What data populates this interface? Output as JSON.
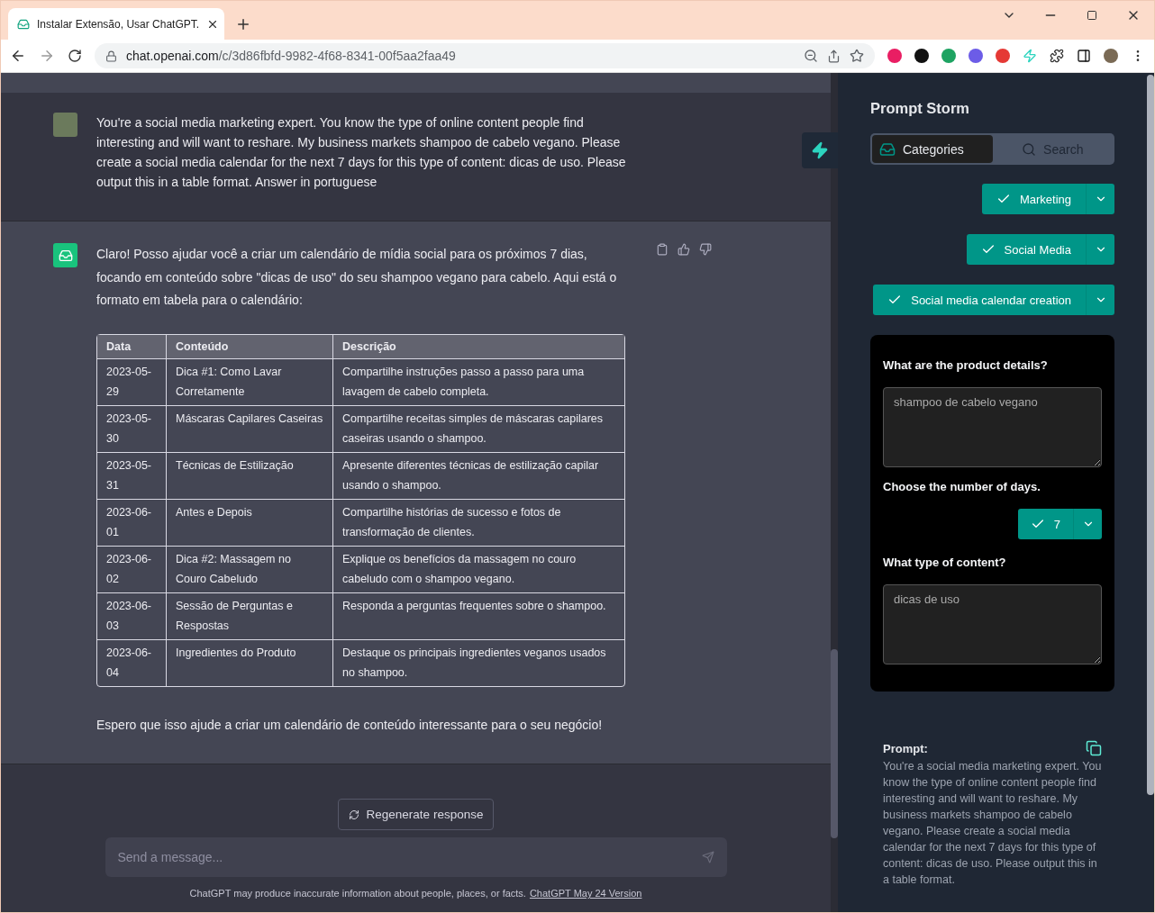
{
  "browser": {
    "tab": {
      "title": "Instalar Extensão, Usar ChatGPT."
    },
    "url": {
      "host": "chat.openai.com",
      "path": "/c/3d86fbfd-9982-4f68-8341-00f5aa2faa49"
    }
  },
  "chat": {
    "messages": [
      {
        "kind": "user",
        "paragraphs": [
          "You're a social media marketing expert. You know the type of online content people find interesting and will want to reshare. My business markets shampoo de cabelo vegano. Please create a social media calendar for the next 7 days for this type of content: dicas de uso. Please output this in a table format. Answer in portuguese"
        ]
      },
      {
        "kind": "assistant",
        "paragraphs": [
          "Claro! Posso ajudar você a criar um calendário de mídia social para os próximos 7 dias, focando em conteúdo sobre \"dicas de uso\" do seu shampoo vegano para cabelo. Aqui está o formato em tabela para o calendário:"
        ],
        "table": {
          "columns": [
            "Data",
            "Conteúdo",
            "Descrição"
          ],
          "rows": [
            [
              "2023-05-29",
              "Dica #1: Como Lavar Corretamente",
              "Compartilhe instruções passo a passo para uma lavagem de cabelo completa."
            ],
            [
              "2023-05-30",
              "Máscaras Capilares Caseiras",
              "Compartilhe receitas simples de máscaras capilares caseiras usando o shampoo."
            ],
            [
              "2023-05-31",
              "Técnicas de Estilização",
              "Apresente diferentes técnicas de estilização capilar usando o shampoo."
            ],
            [
              "2023-06-01",
              "Antes e Depois",
              "Compartilhe histórias de sucesso e fotos de transformação de clientes."
            ],
            [
              "2023-06-02",
              "Dica #2: Massagem no Couro Cabeludo",
              "Explique os benefícios da massagem no couro cabeludo com o shampoo vegano."
            ],
            [
              "2023-06-03",
              "Sessão de Perguntas e Respostas",
              "Responda a perguntas frequentes sobre o shampoo."
            ],
            [
              "2023-06-04",
              "Ingredientes do Produto",
              "Destaque os principais ingredientes veganos usados no shampoo."
            ]
          ]
        },
        "closing": "Espero que isso ajude a criar um calendário de conteúdo interessante para o seu negócio!"
      }
    ],
    "regenerate_button": "Regenerate response",
    "input": {
      "placeholder": "Send a message..."
    },
    "footer": {
      "text": "ChatGPT may produce inaccurate information about people, places, or facts.",
      "link": "ChatGPT May 24 Version"
    }
  },
  "sidebar": {
    "title": "Prompt Storm",
    "tabs": [
      {
        "label": "Categories",
        "selected": true
      },
      {
        "label": "Search",
        "selected": false
      }
    ],
    "categories": [
      {
        "label": "Marketing"
      },
      {
        "label": "Social Media"
      },
      {
        "label": "Social media calendar creation"
      }
    ],
    "form": [
      {
        "kind": "textarea",
        "label": "What are the product details?",
        "value": "shampoo de cabelo vegano"
      },
      {
        "kind": "select",
        "label": "Choose the number of days.",
        "value": "7"
      },
      {
        "kind": "textarea",
        "label": "What type of content?",
        "value": "dicas de uso"
      }
    ],
    "prompt": {
      "label": "Prompt:",
      "text": "You're a social media marketing expert. You know the type of online content people find interesting and will want to reshare. My business markets shampoo de cabelo vegano. Please create a social media calendar for the next 7 days for this type of content: dicas de uso. Please output this in a table format."
    }
  }
}
